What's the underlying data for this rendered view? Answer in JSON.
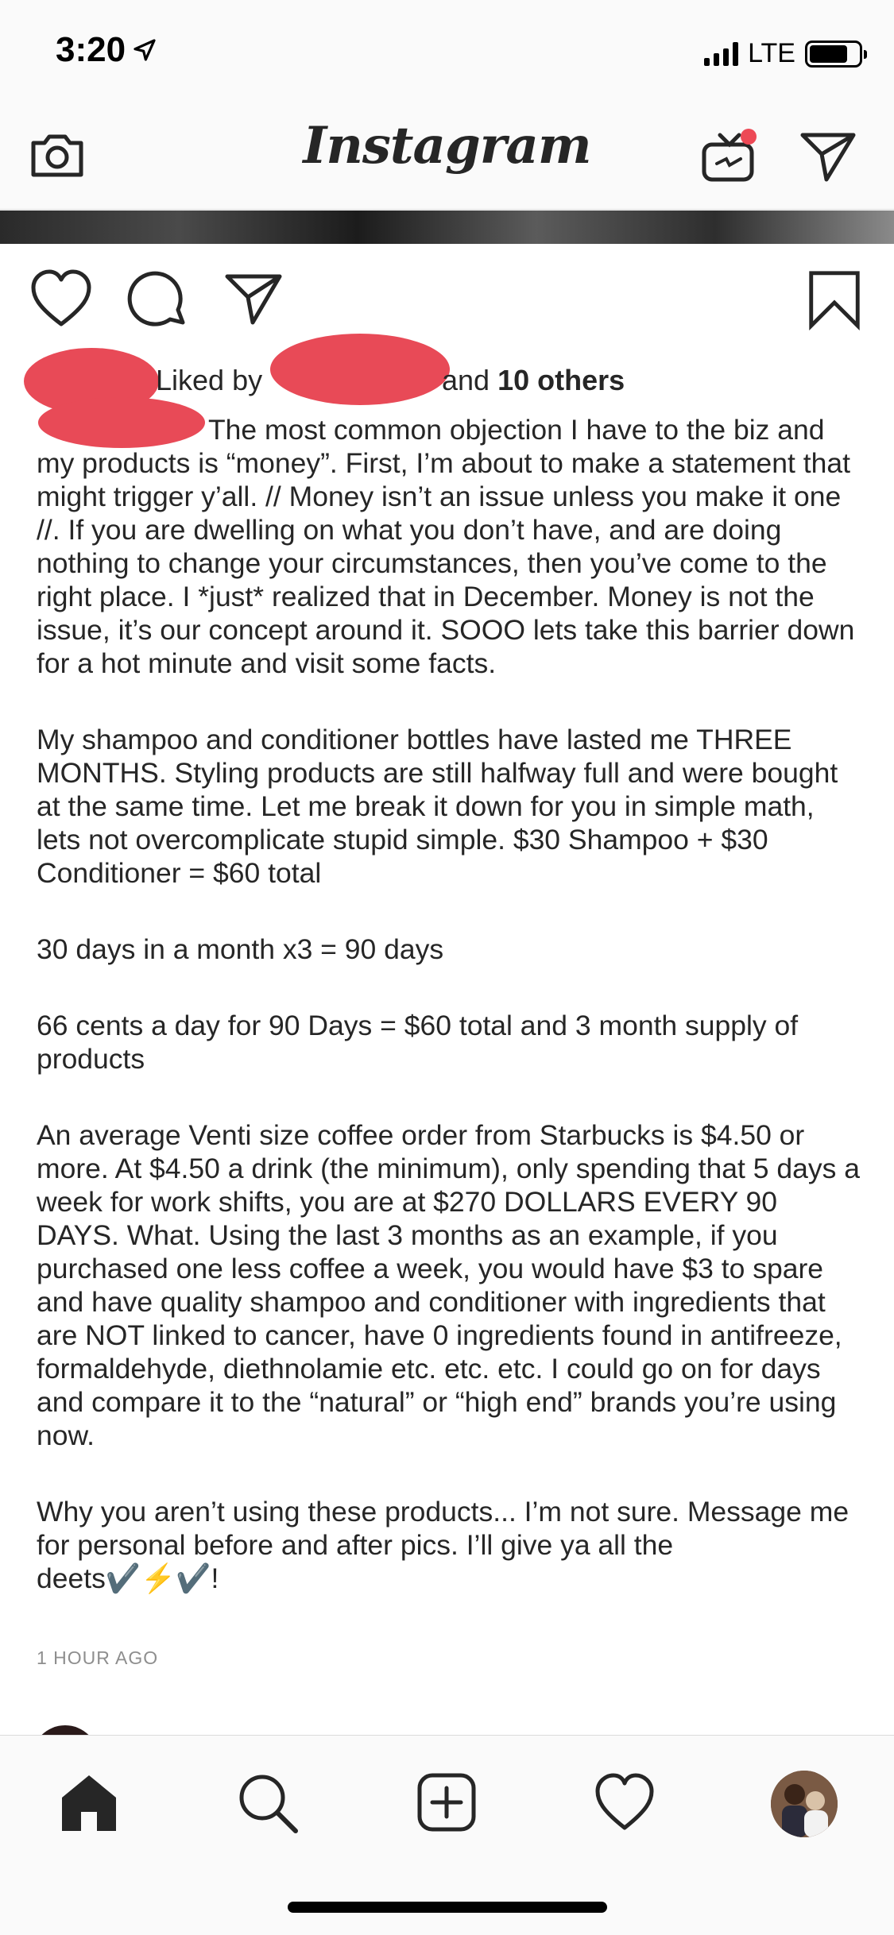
{
  "status_bar": {
    "time": "3:20",
    "network": "LTE",
    "battery_level": 0.78,
    "location_icon": "location-arrow-icon"
  },
  "nav": {
    "title": "Instagram",
    "left_icon": "camera-icon",
    "right_icons": [
      "igtv-icon",
      "direct-message-icon"
    ],
    "igtv_badge_color": "#ed4956"
  },
  "post": {
    "actions": [
      "heart-icon",
      "comment-icon",
      "share-icon",
      "bookmark-icon"
    ],
    "likes": {
      "prefix": "Liked by",
      "and_text": "and",
      "count_text": "10 others"
    },
    "caption": [
      "The most common objection I have to the biz and my products is “money”. First, I’m about to make a statement that might trigger y’all. // Money isn’t an issue unless you make it one //. If you are dwelling on what you don’t have, and are doing nothing to change your circumstances, then you’ve come to the right place. I *just* realized that in December. Money is not the issue, it’s our concept around it. SOOO lets take this barrier down for a hot minute and visit some facts.",
      "My shampoo and conditioner bottles have lasted me THREE MONTHS. Styling products are still halfway full and were bought at the same time. Let me break it down for you in simple math, lets not overcomplicate stupid simple. $30 Shampoo + $30 Conditioner = $60 total",
      "30 days in a month x3 = 90 days",
      "66 cents a day for 90 Days = $60 total and 3 month supply of products",
      "An average Venti size coffee order from Starbucks is $4.50 or more. At $4.50 a drink (the minimum), only spending that 5 days a week for work shifts, you are at $270 DOLLARS EVERY 90 DAYS. What.  Using the last 3 months as an example, if you purchased one less coffee a week, you would have $3 to spare and have quality shampoo and conditioner with ingredients that are NOT linked to cancer, have 0 ingredients found in antifreeze, formaldehyde, diethnolamie etc. etc. etc. I could go on for days and compare it to the “natural” or “high end” brands you’re using now.",
      "Why you aren’t using these products... I’m not sure. Message me for personal before and after pics. I’ll give ya all the deets✔️⚡️✔️!"
    ],
    "time_ago": "1 HOUR AGO"
  },
  "tab_bar": {
    "items": [
      "home-icon",
      "search-icon",
      "add-post-icon",
      "activity-heart-icon",
      "profile-avatar"
    ]
  },
  "colors": {
    "redaction": "#e84a57",
    "text": "#262626",
    "muted": "#8e8e8e",
    "bar_bg": "#fafafa"
  }
}
